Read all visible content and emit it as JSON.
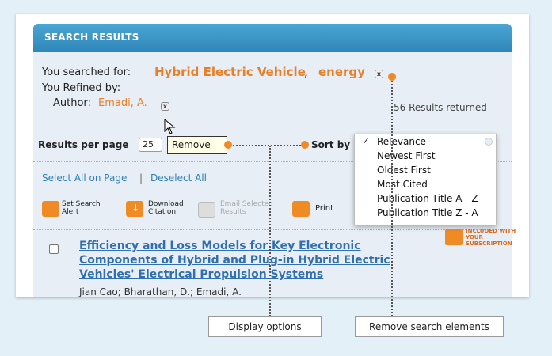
{
  "header": {
    "title": "SEARCH RESULTS"
  },
  "search": {
    "you_searched_label": "You searched for:",
    "term1": "Hybrid Electric Vehicle",
    "comma": ",",
    "term2": "energy",
    "remove_x": "x",
    "refined_label": "You Refined by:",
    "author_label": "Author:",
    "author_value": "Emadi, A.",
    "results_count": "56 Results returned"
  },
  "controls": {
    "per_page_label": "Results per page",
    "per_page_value": "25",
    "tooltip": "Remove",
    "sort_label": "Sort by",
    "sort_options": [
      "Relevance",
      "Newest First",
      "Oldest First",
      "Most Cited",
      "Publication Title A - Z",
      "Publication Title Z - A"
    ],
    "selected_check": "✓"
  },
  "selection": {
    "select_all": "Select All on Page",
    "divider": "|",
    "deselect_all": "Deselect All"
  },
  "toolbar": {
    "set_alert_line1": "Set Search",
    "set_alert_line2": "Alert",
    "download_line1": "Download",
    "download_line2": "Citation",
    "email_line1": "Email Selected",
    "email_line2": "Results",
    "print": "Print"
  },
  "result": {
    "title": "Efficiency and Loss Models for Key Electronic Components of Hybrid and Plug-in Hybrid Electric Vehicles' Electrical Propulsion Systems",
    "authors": "Jian Cao; Bharathan, D.; Emadi, A.",
    "badge": "INCLUDED WITH YOUR SUBSCRIPTION"
  },
  "callouts": {
    "display_options": "Display options",
    "remove_elements": "Remove search elements"
  },
  "colors": {
    "accent": "#e8802a",
    "header_blue": "#3b95c6",
    "link": "#2f7fb6"
  }
}
